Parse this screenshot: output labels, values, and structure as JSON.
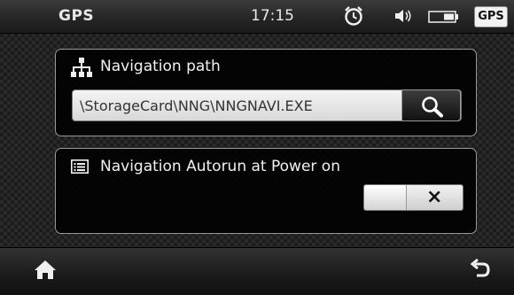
{
  "status_bar": {
    "title": "GPS",
    "time": "17:15",
    "gps_badge": "GPS",
    "icons": [
      "alarm-clock-icon",
      "speaker-icon",
      "battery-icon"
    ]
  },
  "navigation_path": {
    "label": "Navigation path",
    "icon": "sitemap-icon",
    "value": "\\StorageCard\\NNG\\NNGNAVI.EXE",
    "search_icon": "search-icon"
  },
  "autorun": {
    "label": "Navigation Autorun at Power on",
    "icon": "list-icon",
    "toggle_state": "off",
    "toggle_symbol": "×"
  },
  "bottom_bar": {
    "left_icon": "home-icon",
    "right_icon": "back-arrow-icon"
  }
}
